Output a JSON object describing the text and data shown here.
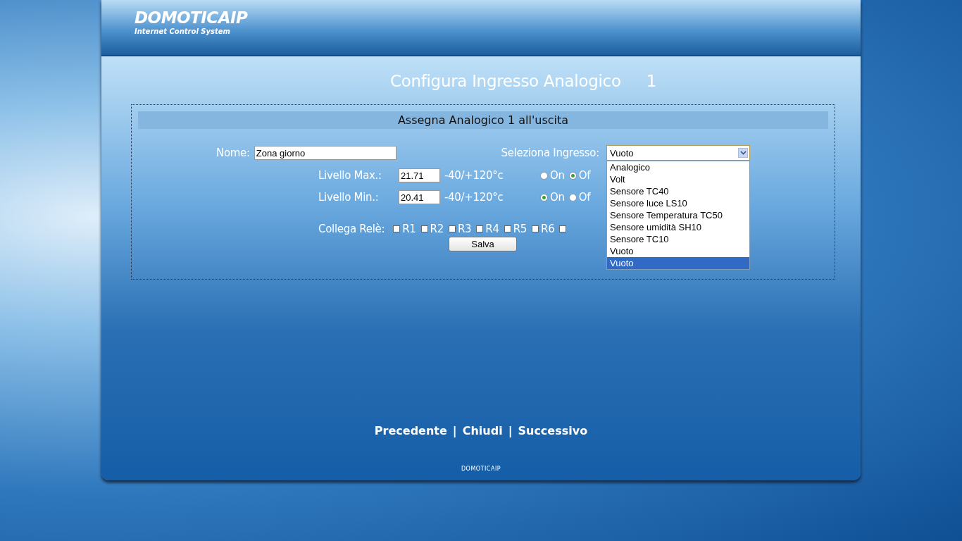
{
  "header": {
    "logo": "DOMOTICAIP",
    "tagline": "Internet Control System"
  },
  "title": {
    "text": "Configura Ingresso Analogico",
    "number": "1"
  },
  "form": {
    "legend": "Assegna Analogico 1 all'uscita",
    "name_label": "Nome:",
    "name_value": "Zona giorno",
    "input_label": "Seleziona Ingresso:",
    "input_value": "Vuoto",
    "options": [
      {
        "label": "Analogico",
        "selected": false
      },
      {
        "label": "Volt",
        "selected": false
      },
      {
        "label": "Sensore TC40",
        "selected": false
      },
      {
        "label": "Sensore luce LS10",
        "selected": false
      },
      {
        "label": "Sensore Temperatura TC50",
        "selected": false
      },
      {
        "label": "Sensore umidità SH10",
        "selected": false
      },
      {
        "label": "Sensore TC10",
        "selected": false
      },
      {
        "label": "Vuoto",
        "selected": false
      },
      {
        "label": "Vuoto",
        "selected": true
      }
    ],
    "levels": [
      {
        "label": "Livello Max.:",
        "value": "21.71",
        "range": "-40/+120°c",
        "radios": [
          {
            "label": "On",
            "selected": false
          },
          {
            "label": "Of",
            "selected": true
          }
        ]
      },
      {
        "label": "Livello Min.:",
        "value": "20.41",
        "range": "-40/+120°c",
        "radios": [
          {
            "label": "On",
            "selected": true
          },
          {
            "label": "Of",
            "selected": false
          }
        ]
      }
    ],
    "relay_label": "Collega Relè:",
    "relays": [
      {
        "label": "R1",
        "checked": false
      },
      {
        "label": "R2",
        "checked": false
      },
      {
        "label": "R3",
        "checked": false
      },
      {
        "label": "R4",
        "checked": false
      },
      {
        "label": "R5",
        "checked": false
      },
      {
        "label": "R6",
        "checked": false
      },
      {
        "checked": false
      }
    ],
    "save": "Salva"
  },
  "nav": [
    {
      "label": "Precedente"
    },
    {
      "label": "Chiudi"
    },
    {
      "label": "Successivo"
    }
  ],
  "separator": "|",
  "footer": "DOMOTICAIP"
}
